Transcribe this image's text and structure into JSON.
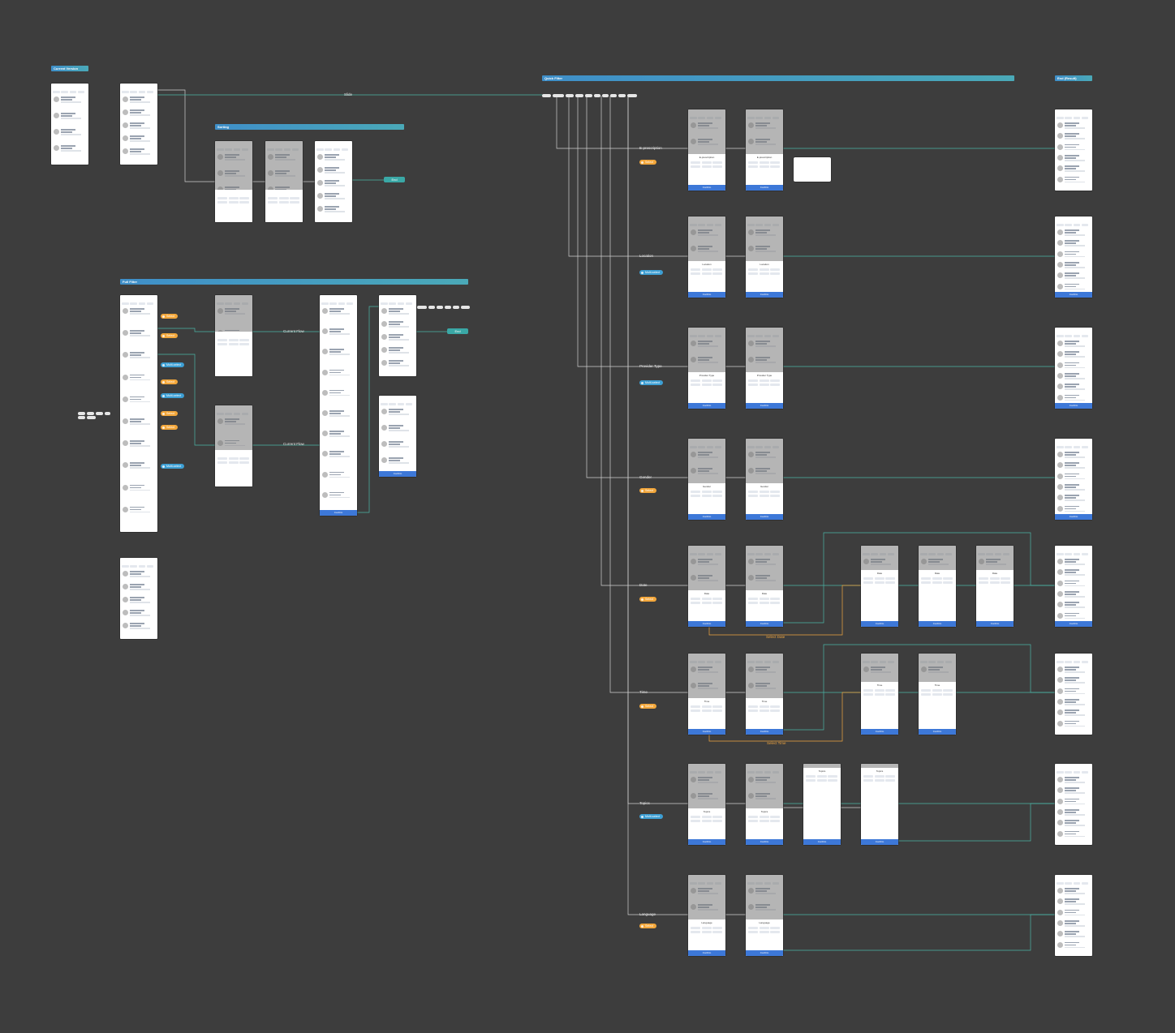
{
  "sections": {
    "current_version": "Current Version",
    "sorting": "Sorting",
    "full_filter": "Full Filter",
    "quick_filter": "Quick Filter",
    "end_result": "End (Result)"
  },
  "flow_labels": {
    "slide": "Slide",
    "end": "End",
    "current_flow": "Current Flow",
    "select_date": "Select Date",
    "select_time": "Select Time"
  },
  "quick_filter_rows": [
    {
      "label": "E-prescription",
      "badge": "Select",
      "badge_type": "single"
    },
    {
      "label": "Location",
      "badge": "Multi-select",
      "badge_type": "multi"
    },
    {
      "label": "Provider Type",
      "badge": "Multi-select",
      "badge_type": "multi"
    },
    {
      "label": "Gender",
      "badge": "Select",
      "badge_type": "single"
    },
    {
      "label": "Date",
      "badge": "Select",
      "badge_type": "single"
    },
    {
      "label": "Time",
      "badge": "Select",
      "badge_type": "single"
    },
    {
      "label": "Topics",
      "badge": "Multi-select",
      "badge_type": "multi"
    },
    {
      "label": "Language",
      "badge": "Select",
      "badge_type": "single"
    }
  ],
  "full_filter_badges": [
    {
      "label": "Select",
      "badge_type": "single"
    },
    {
      "label": "Select",
      "badge_type": "single"
    },
    {
      "label": "Multi-select",
      "badge_type": "multi"
    },
    {
      "label": "Select",
      "badge_type": "single"
    },
    {
      "label": "Multi-select",
      "badge_type": "multi"
    },
    {
      "label": "Select",
      "badge_type": "single"
    },
    {
      "label": "Select",
      "badge_type": "single"
    },
    {
      "label": "Multi-select",
      "badge_type": "multi"
    }
  ],
  "sheet_titles": [
    "E-prescription",
    "Location",
    "Provider Type",
    "Gender",
    "Date",
    "Time",
    "Topics",
    "Language"
  ],
  "confirm_label": "Confirm",
  "colors": {
    "canvas": "#3d3d3d",
    "section_band": "#3f8fc9",
    "connector_teal": "#4bb5a6",
    "connector_orange": "#f0a640",
    "single_badge": "#f3a73b",
    "multi_badge": "#3d9fd4",
    "primary_button": "#3d78d8"
  }
}
